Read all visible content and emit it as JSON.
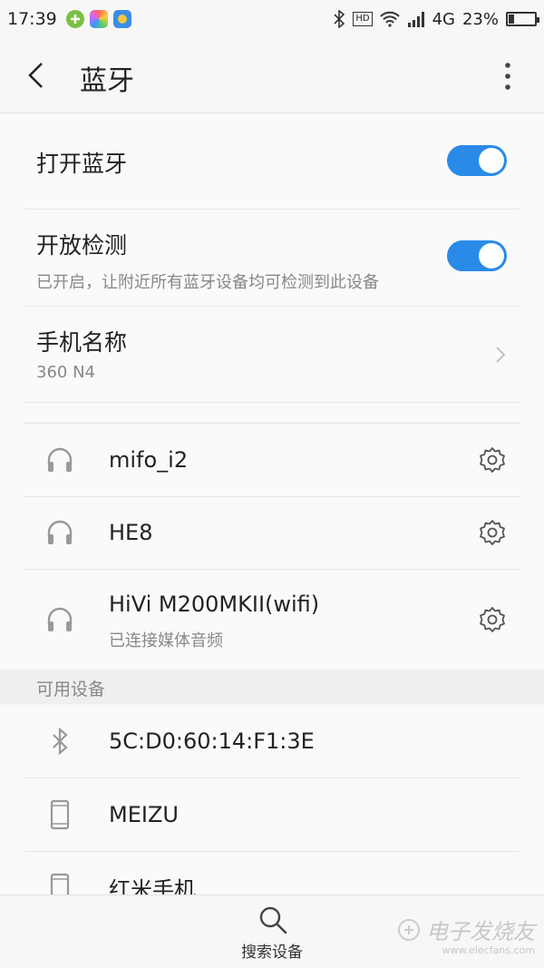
{
  "status_bar": {
    "time": "17:39",
    "network": "4G",
    "battery_percent": "23%",
    "battery_level": 0.23,
    "hd_label": "HD",
    "icons": [
      "plus-circle-icon",
      "colorful-app-icon",
      "yellow-app-icon",
      "bluetooth-icon",
      "hd-icon",
      "wifi-icon",
      "signal-icon",
      "battery-icon"
    ]
  },
  "header": {
    "title": "蓝牙",
    "back_icon": "back-arrow-icon",
    "more_icon": "more-vertical-icon"
  },
  "settings": {
    "bluetooth_toggle": {
      "label": "打开蓝牙",
      "on": true
    },
    "discoverable_toggle": {
      "label": "开放检测",
      "sub": "已开启，让附近所有蓝牙设备均可检测到此设备",
      "on": true
    },
    "device_name": {
      "label": "手机名称",
      "value": "360 N4"
    }
  },
  "paired_devices": [
    {
      "name": "mifo_i2",
      "icon": "headphones-icon",
      "sub": ""
    },
    {
      "name": "HE8",
      "icon": "headphones-icon",
      "sub": ""
    },
    {
      "name": "HiVi M200MKII(wifi)",
      "icon": "headphones-icon",
      "sub": "已连接媒体音频"
    }
  ],
  "available_section": {
    "title": "可用设备"
  },
  "available_devices": [
    {
      "name": "5C:D0:60:14:F1:3E",
      "icon": "bluetooth-icon"
    },
    {
      "name": "MEIZU",
      "icon": "phone-icon"
    },
    {
      "name": "红米手机",
      "icon": "phone-icon"
    }
  ],
  "bottom_bar": {
    "scan_label": "搜索设备",
    "scan_icon": "search-icon"
  },
  "watermark": {
    "title": "电子发烧友",
    "url": "www.elecfans.com"
  },
  "colors": {
    "accent": "#2a8ae8",
    "text_primary": "#222222",
    "text_secondary": "#888888"
  }
}
